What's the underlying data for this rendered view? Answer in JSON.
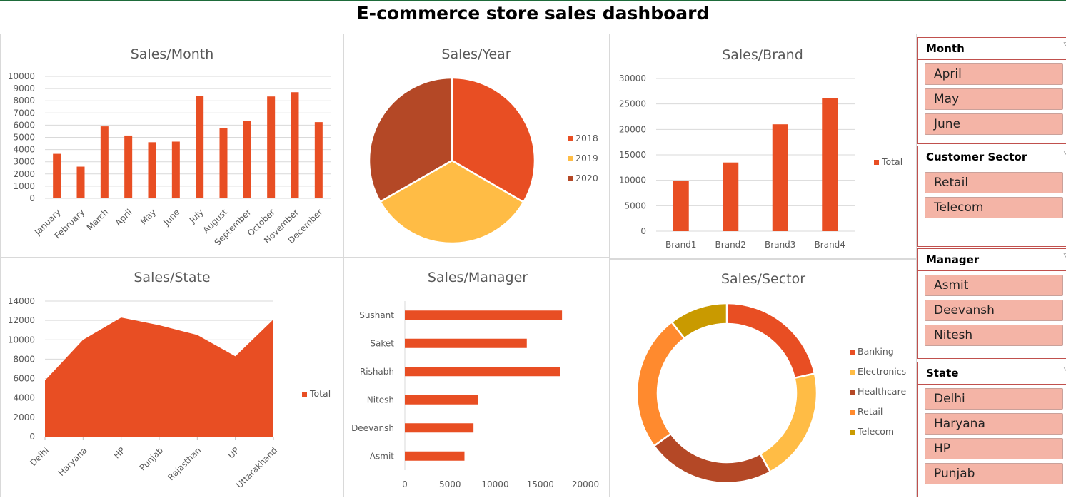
{
  "dashboard": {
    "title": "E-commerce store sales dashboard"
  },
  "colors": {
    "primary": "#e84e23",
    "yellow": "#ffbc45",
    "brown": "#b44826",
    "orange": "#ff8a2e",
    "olive": "#c99a00",
    "slicer_item": "#f4b4a6"
  },
  "charts": {
    "month": {
      "title": "Sales/Month",
      "chart_data": {
        "type": "bar",
        "categories": [
          "January",
          "February",
          "March",
          "April",
          "May",
          "June",
          "July",
          "August",
          "September",
          "October",
          "November",
          "December"
        ],
        "values": [
          3650,
          2600,
          5900,
          5150,
          4600,
          4650,
          8400,
          5750,
          6350,
          8350,
          8700,
          6250
        ],
        "ylim": [
          0,
          10000
        ],
        "yticks": [
          "0",
          "1000",
          "2000",
          "3000",
          "4000",
          "5000",
          "6000",
          "7000",
          "8000",
          "9000",
          "10000"
        ],
        "grid": true
      }
    },
    "year": {
      "title": "Sales/Year",
      "chart_data": {
        "type": "pie",
        "labels": [
          "2018",
          "2019",
          "2020"
        ],
        "values": [
          33.4,
          33.3,
          33.3
        ],
        "legend": "right"
      }
    },
    "brand": {
      "title": "Sales/Brand",
      "chart_data": {
        "type": "bar",
        "categories": [
          "Brand1",
          "Brand2",
          "Brand3",
          "Brand4"
        ],
        "series": [
          {
            "name": "Total",
            "values": [
              9900,
              13500,
              21000,
              26200
            ]
          }
        ],
        "ylim": [
          0,
          30000
        ],
        "yticks": [
          "0",
          "5000",
          "10000",
          "15000",
          "20000",
          "25000",
          "30000"
        ],
        "legend": "right",
        "grid": true
      }
    },
    "state": {
      "title": "Sales/State",
      "chart_data": {
        "type": "area",
        "categories": [
          "Delhi",
          "Haryana",
          "HP",
          "Punjab",
          "Rajasthan",
          "UP",
          "Uttarakhand"
        ],
        "series": [
          {
            "name": "Total",
            "values": [
              5800,
              10000,
              12300,
              11500,
              10500,
              8300,
              12100
            ]
          }
        ],
        "ylim": [
          0,
          14000
        ],
        "yticks": [
          "0",
          "2000",
          "4000",
          "6000",
          "8000",
          "10000",
          "12000",
          "14000"
        ],
        "legend": "right",
        "grid": true
      }
    },
    "manager": {
      "title": "Sales/Manager",
      "chart_data": {
        "type": "bar",
        "orientation": "horizontal",
        "categories": [
          "Sushant",
          "Saket",
          "Rishabh",
          "Nitesh",
          "Deevansh",
          "Asmit"
        ],
        "values": [
          17400,
          13500,
          17200,
          8100,
          7600,
          6600
        ],
        "xlim": [
          0,
          20000
        ],
        "xticks": [
          "0",
          "5000",
          "10000",
          "15000",
          "20000"
        ]
      }
    },
    "sector": {
      "title": "Sales/Sector",
      "chart_data": {
        "type": "pie",
        "style": "doughnut",
        "labels": [
          "Banking",
          "Electronics",
          "Healthcare",
          "Retail",
          "Telecom"
        ],
        "values": [
          21.5,
          20.5,
          23.0,
          24.5,
          10.5
        ],
        "legend": "right"
      }
    }
  },
  "slicers": [
    {
      "header": "Month",
      "items": [
        "April",
        "May",
        "June"
      ]
    },
    {
      "header": "Customer Sector",
      "items": [
        "Retail",
        "Telecom"
      ]
    },
    {
      "header": "Manager",
      "items": [
        "Asmit",
        "Deevansh",
        "Nitesh"
      ]
    },
    {
      "header": "State",
      "items": [
        "Delhi",
        "Haryana",
        "HP",
        "Punjab"
      ]
    }
  ]
}
